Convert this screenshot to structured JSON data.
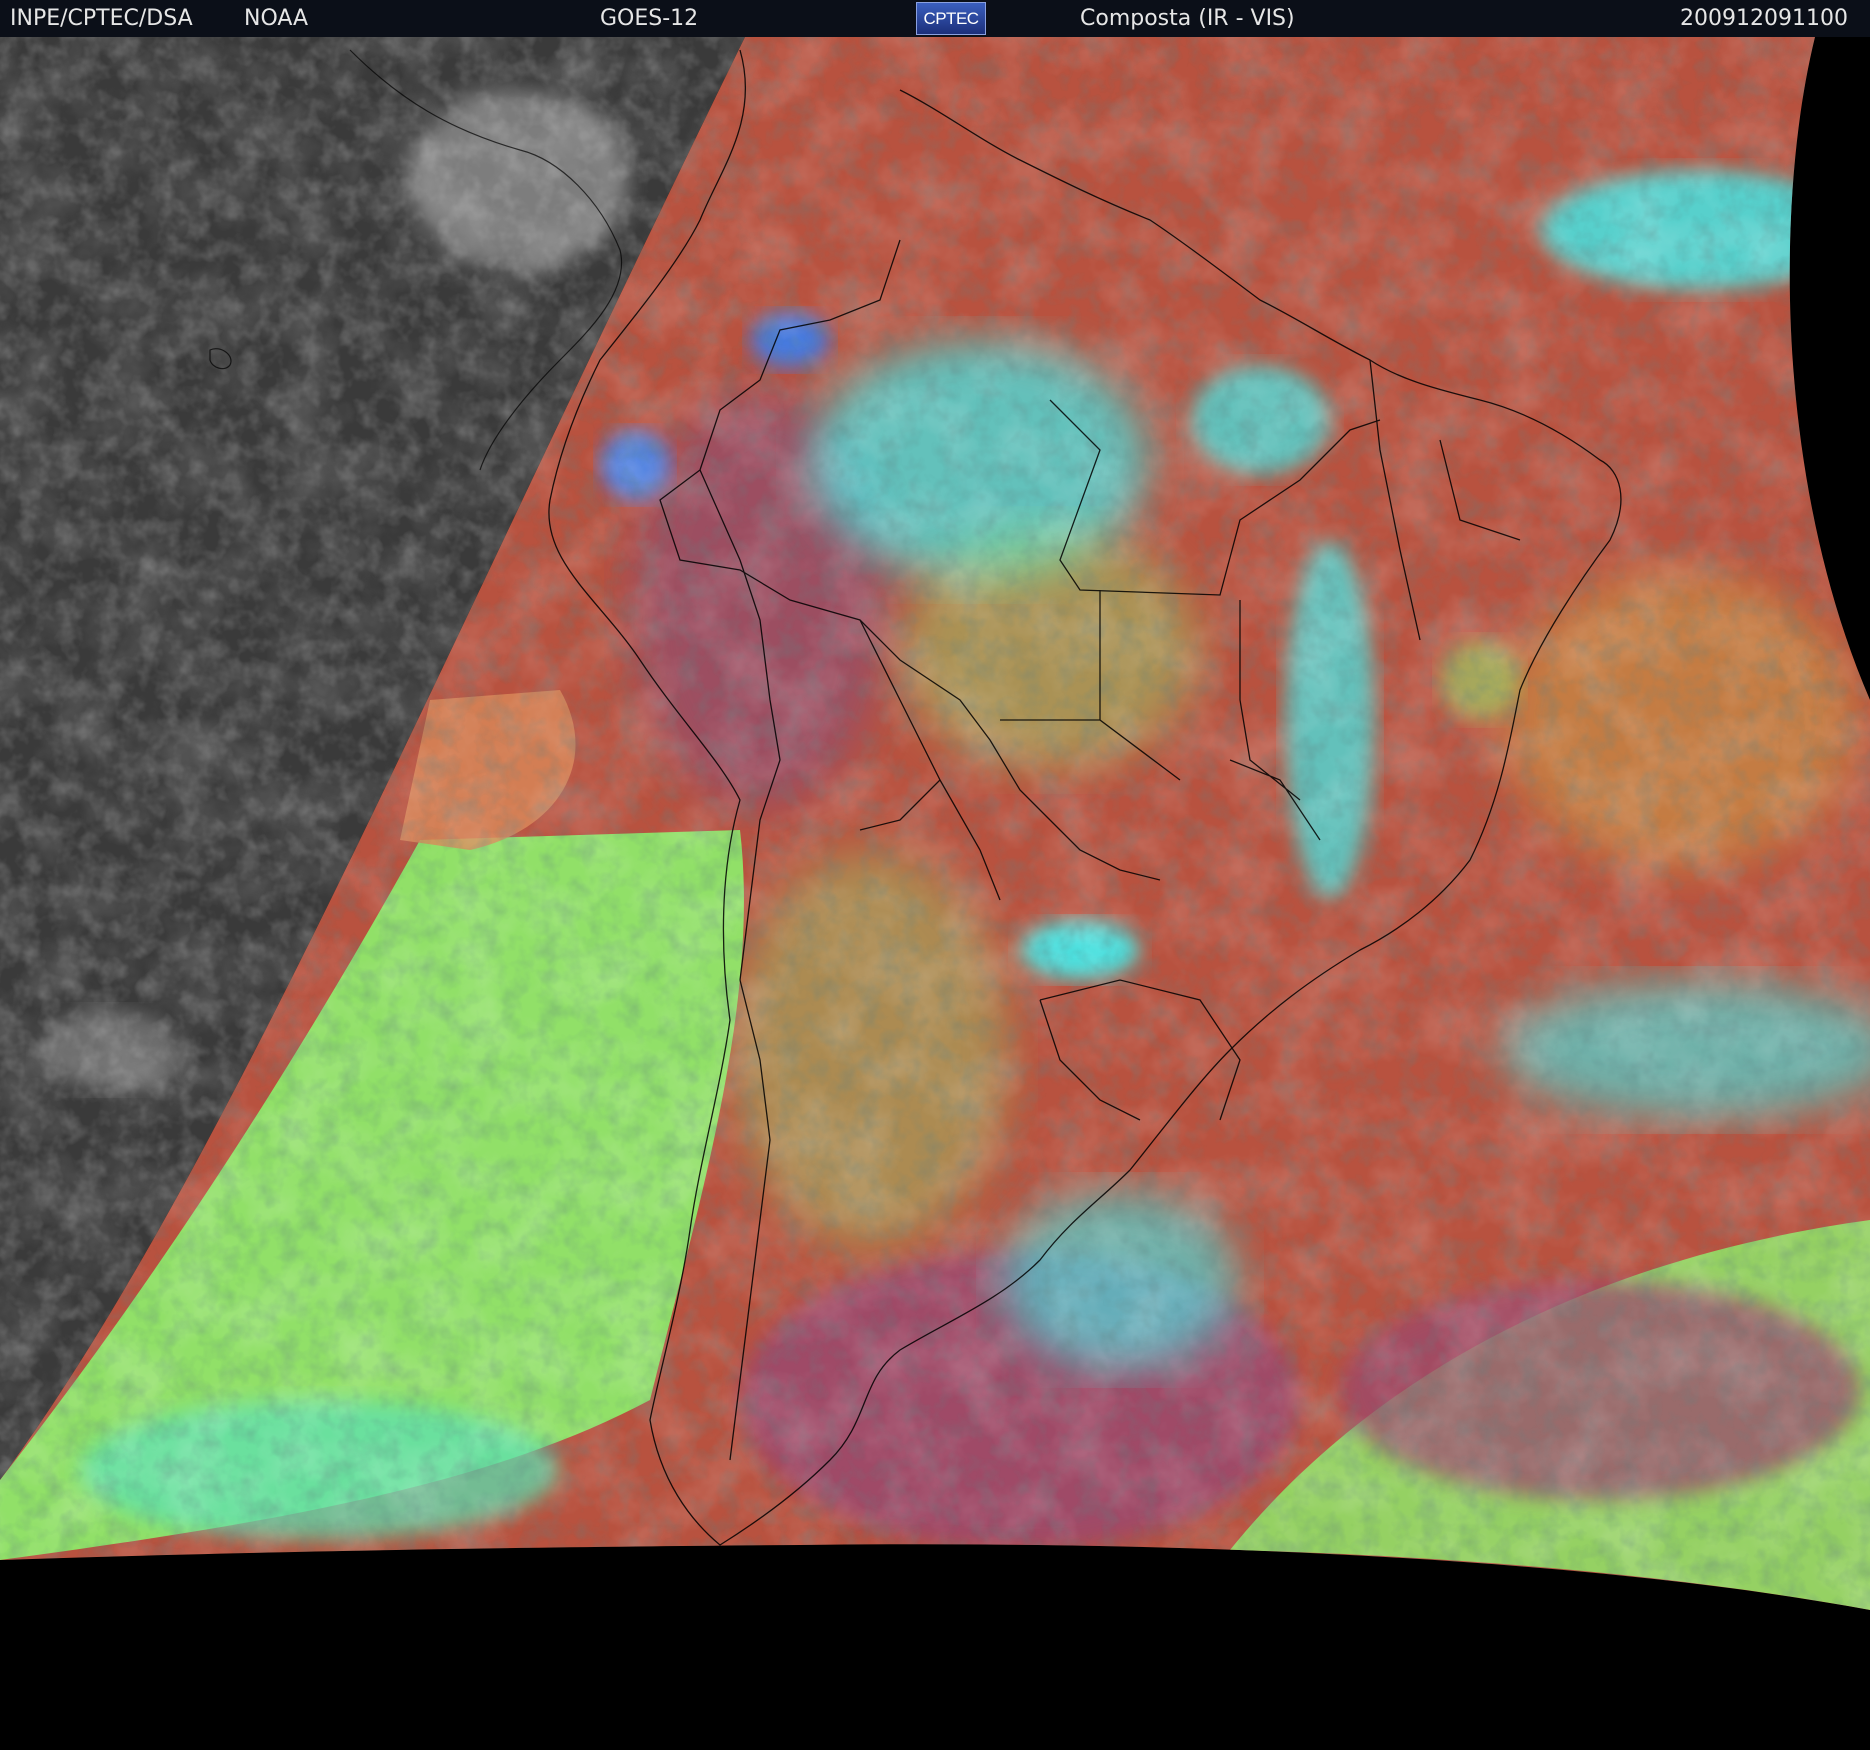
{
  "header": {
    "organization": "INPE/CPTEC/DSA",
    "agency": "NOAA",
    "satellite": "GOES-12",
    "logo_text": "CPTEC",
    "product": "Composta (IR - VIS)",
    "timestamp": "200912091100"
  },
  "colors": {
    "header_bg": "#0b0f18",
    "space_black": "#000000",
    "night_gray": "#3a3a3a",
    "land_ocean_red": "#b8523f",
    "low_cloud_green": "#8ee86a",
    "high_cloud_cyan": "#3ff0f0",
    "deep_convection_blue": "#3a7ff0",
    "magenta_cloud": "#9b4a6e",
    "border_lines": "#000000"
  },
  "map": {
    "region": "South America",
    "overlays": [
      "country-borders",
      "state-borders",
      "coastlines"
    ]
  }
}
